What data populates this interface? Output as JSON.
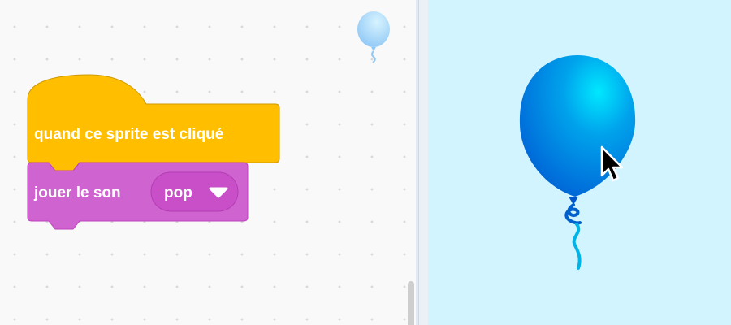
{
  "code_area": {
    "hat_block": {
      "label": "quand ce sprite est cliqué",
      "color": "#ffbf00",
      "border_color": "#cc9900"
    },
    "sound_block": {
      "label": "jouer le son",
      "sound_name": "pop",
      "color": "#cf63cf",
      "border_color": "#bd42bd",
      "dropdown_color": "#c94fc9"
    },
    "sprite_thumbnail_icon": "balloon-icon"
  },
  "stage": {
    "background_color": "#d1f4ff",
    "sprite_icon": "balloon-icon",
    "balloon_color": "#0088e0",
    "cursor_icon": "arrow-cursor-icon"
  }
}
